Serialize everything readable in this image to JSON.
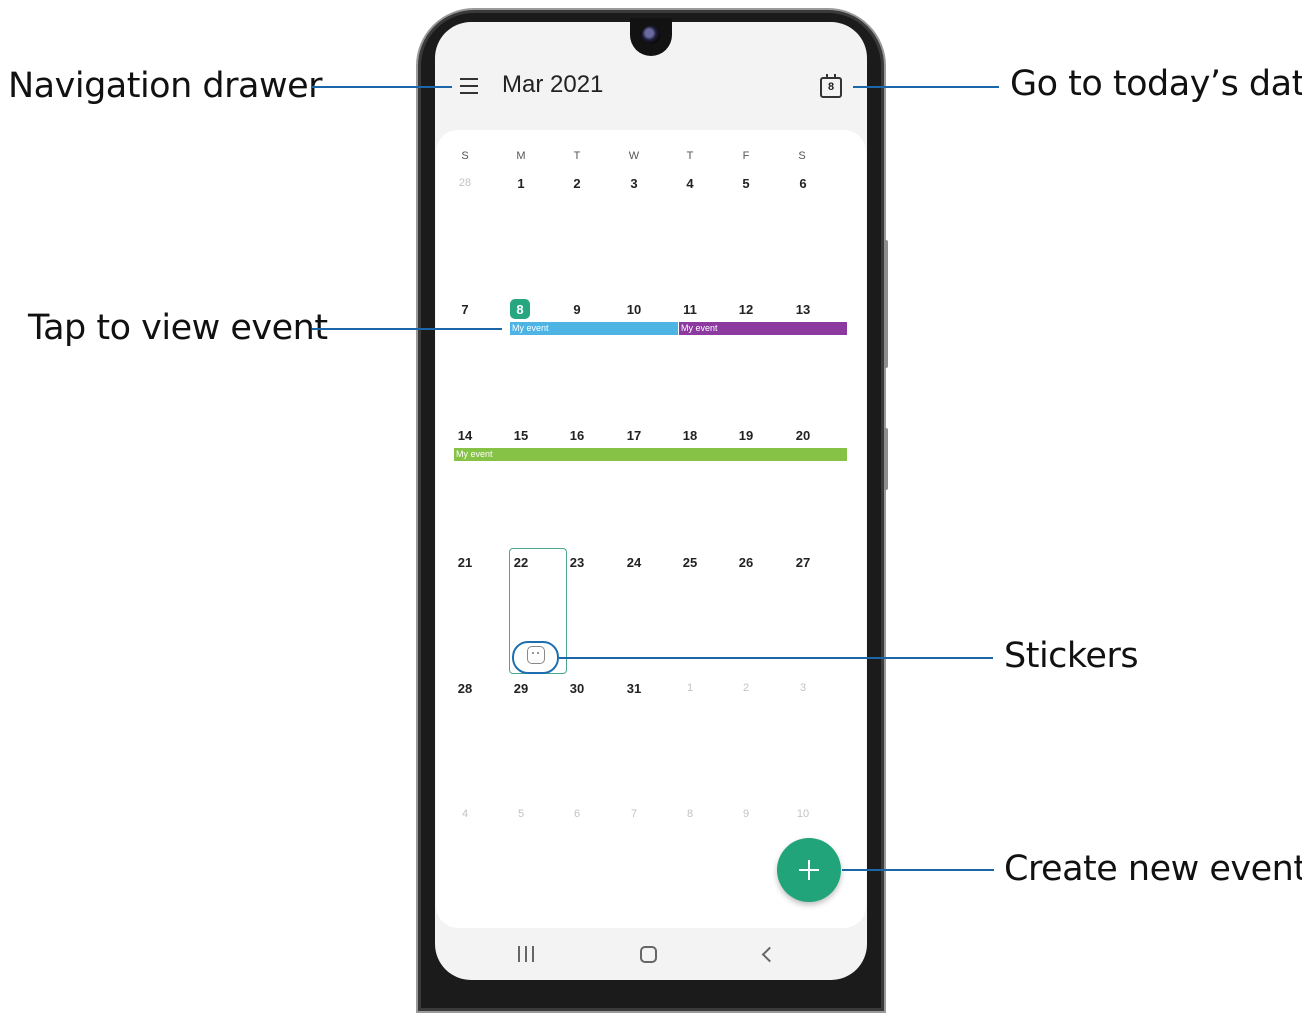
{
  "app": {
    "header_title": "Mar 2021",
    "today_icon_number": "8",
    "menu_icon": "hamburger-icon",
    "today_icon": "calendar-today-icon"
  },
  "calendar": {
    "weekdays": [
      "S",
      "M",
      "T",
      "W",
      "T",
      "F",
      "S"
    ],
    "weeks": [
      [
        "28",
        "1",
        "2",
        "3",
        "4",
        "5",
        "6"
      ],
      [
        "7",
        "8",
        "9",
        "10",
        "11",
        "12",
        "13"
      ],
      [
        "14",
        "15",
        "16",
        "17",
        "18",
        "19",
        "20"
      ],
      [
        "21",
        "22",
        "23",
        "24",
        "25",
        "26",
        "27"
      ],
      [
        "28",
        "29",
        "30",
        "31",
        "1",
        "2",
        "3"
      ],
      [
        "4",
        "5",
        "6",
        "7",
        "8",
        "9",
        "10"
      ]
    ],
    "today": "8",
    "selected_day": "22",
    "events": [
      {
        "label": "My event",
        "color": "#4db4e4"
      },
      {
        "label": "My event",
        "color": "#8c3aa0"
      },
      {
        "label": "My event",
        "color": "#86c246"
      }
    ],
    "sticker_icon": "sticker-icon"
  },
  "fab": {
    "icon": "plus-icon"
  },
  "system_nav": {
    "recent": "recent-apps-icon",
    "home": "home-icon",
    "back": "back-icon"
  },
  "callouts": {
    "navigation_drawer": "Navigation drawer",
    "go_to_today": "Go to today’s date",
    "tap_to_view_event": "Tap to view event",
    "stickers": "Stickers",
    "create_new_event": "Create new event"
  },
  "colors": {
    "accent": "#27a77f",
    "callout_line": "#1a66a8"
  }
}
